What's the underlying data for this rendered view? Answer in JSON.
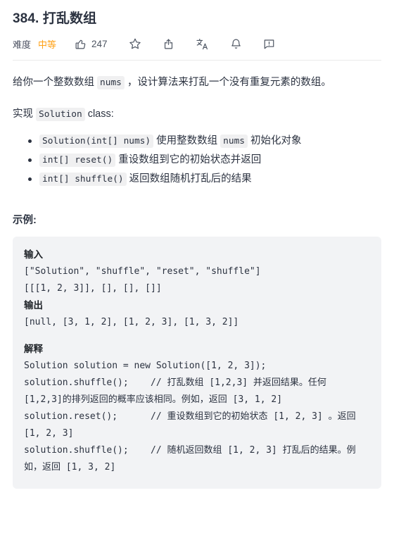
{
  "problem": {
    "number": "384.",
    "title": "打乱数组",
    "difficulty_label": "难度",
    "difficulty_value": "中等",
    "difficulty_color": "#ffa116"
  },
  "actions": [
    {
      "name": "thumbs-up-icon",
      "label": "",
      "count": "247"
    },
    {
      "name": "star-icon",
      "label": ""
    },
    {
      "name": "share-icon",
      "label": ""
    },
    {
      "name": "translate-icon",
      "label": ""
    },
    {
      "name": "bell-icon",
      "label": ""
    },
    {
      "name": "report-icon",
      "label": ""
    }
  ],
  "description": {
    "intro_a": "给你一个整数数组 ",
    "intro_code": "nums",
    "intro_b": " ，设计算法来打乱一个没有重复元素的数组。",
    "implement_a": "实现 ",
    "implement_code": "Solution",
    "implement_b": " class:"
  },
  "methods": [
    {
      "code": "Solution(int[] nums)",
      "text_a": " 使用整数数组 ",
      "code2": "nums",
      "text_b": " 初始化对象"
    },
    {
      "code": "int[] reset()",
      "text_a": " 重设数组到它的初始状态并返回",
      "code2": "",
      "text_b": ""
    },
    {
      "code": "int[] shuffle()",
      "text_a": " 返回数组随机打乱后的结果",
      "code2": "",
      "text_b": ""
    }
  ],
  "example": {
    "heading": "示例:",
    "input_label": "输入",
    "input_line1": "[\"Solution\", \"shuffle\", \"reset\", \"shuffle\"]",
    "input_line2": "[[[1, 2, 3]], [], [], []]",
    "output_label": "输出",
    "output_line1": "[null, [3, 1, 2], [1, 2, 3], [1, 3, 2]]",
    "explain_label": "解释",
    "explain_body": "Solution solution = new Solution([1, 2, 3]);\nsolution.shuffle();    // 打乱数组 [1,2,3] 并返回结果。任何 [1,2,3]的排列返回的概率应该相同。例如，返回 [3, 1, 2]\nsolution.reset();      // 重设数组到它的初始状态 [1, 2, 3] 。返回 [1, 2, 3]\nsolution.shuffle();    // 随机返回数组 [1, 2, 3] 打乱后的结果。例如，返回 [1, 3, 2]"
  }
}
